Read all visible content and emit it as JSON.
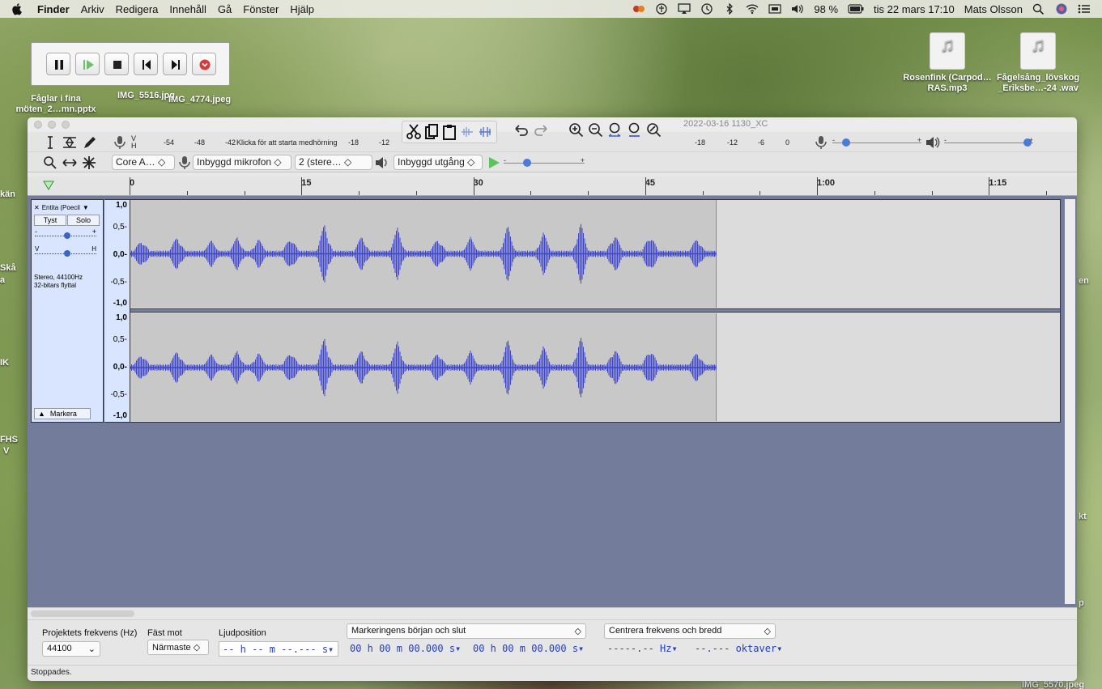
{
  "menubar": {
    "app": "Finder",
    "items": [
      "Arkiv",
      "Redigera",
      "Innehåll",
      "Gå",
      "Fönster",
      "Hjälp"
    ],
    "battery": "98 %",
    "datetime": "tis 22 mars 17:10",
    "user": "Mats Olsson"
  },
  "desktop": {
    "icons": [
      {
        "name": "Rosenfink (Carpod…RAS.mp3"
      },
      {
        "name": "Fågelsång_lövskog _Eriksbe…-24 .wav"
      }
    ],
    "labels": {
      "faglar": "Fåglar i fina möten_2…mn.pptx",
      "img5516": "IMG_5516.jpg",
      "img4774": "IMG_4774.jpeg",
      "kan": "kän",
      "ska": "Skå",
      "a": "a",
      "en": "en",
      "ik": "IK",
      "fhs": "FHS",
      "v": "V",
      "kt": "kt",
      "p": "p",
      "img5570": "IMG_5570.jpeg"
    }
  },
  "audacity": {
    "window_title": "2022-03-16 1130_XC",
    "meter": {
      "record_ticks": [
        "-54",
        "-48",
        "-42",
        "-18",
        "-12"
      ],
      "start_monitoring": "Klicka för att starta medhörning",
      "play_ticks": [
        "-18",
        "-12",
        "-6",
        "0"
      ],
      "vh_top": "V",
      "vh_bottom": "H"
    },
    "devices": {
      "host": "Core A…",
      "input": "Inbyggd mikrofon",
      "channels": "2 (stere…",
      "output": "Inbyggd utgång"
    },
    "timeline": {
      "labels": [
        "0",
        "15",
        "30",
        "45",
        "1:00",
        "1:15"
      ]
    },
    "track": {
      "name": "Entita (Poecil",
      "mute": "Tyst",
      "solo": "Solo",
      "gain_minus": "-",
      "gain_plus": "+",
      "pan_left": "V",
      "pan_right": "H",
      "info_line1": "Stereo, 44100Hz",
      "info_line2": "32-bitars flyttal",
      "select": "Markera",
      "ruler": [
        "1,0",
        "0,5-",
        "0,0-",
        "-0,5-",
        "-1,0"
      ],
      "wave_color": "#3c44d0"
    },
    "selection_bar": {
      "rate_label": "Projektets frekvens (Hz)",
      "rate_value": "44100",
      "snap_label": "Fäst mot",
      "snap_value": "Närmaste",
      "position_label": "Ljudposition",
      "position_value": "-- h -- m --.--- s",
      "selection_mode": "Markeringens början och slut",
      "sel_start": "00 h 00 m 00.000 s",
      "sel_end": "00 h 00 m 00.000 s",
      "spectral_mode": "Centrera frekvens och bredd",
      "freq_value": "-----.-- Hz",
      "width_value": "--.--- oktaver"
    },
    "status": "Stoppades."
  }
}
